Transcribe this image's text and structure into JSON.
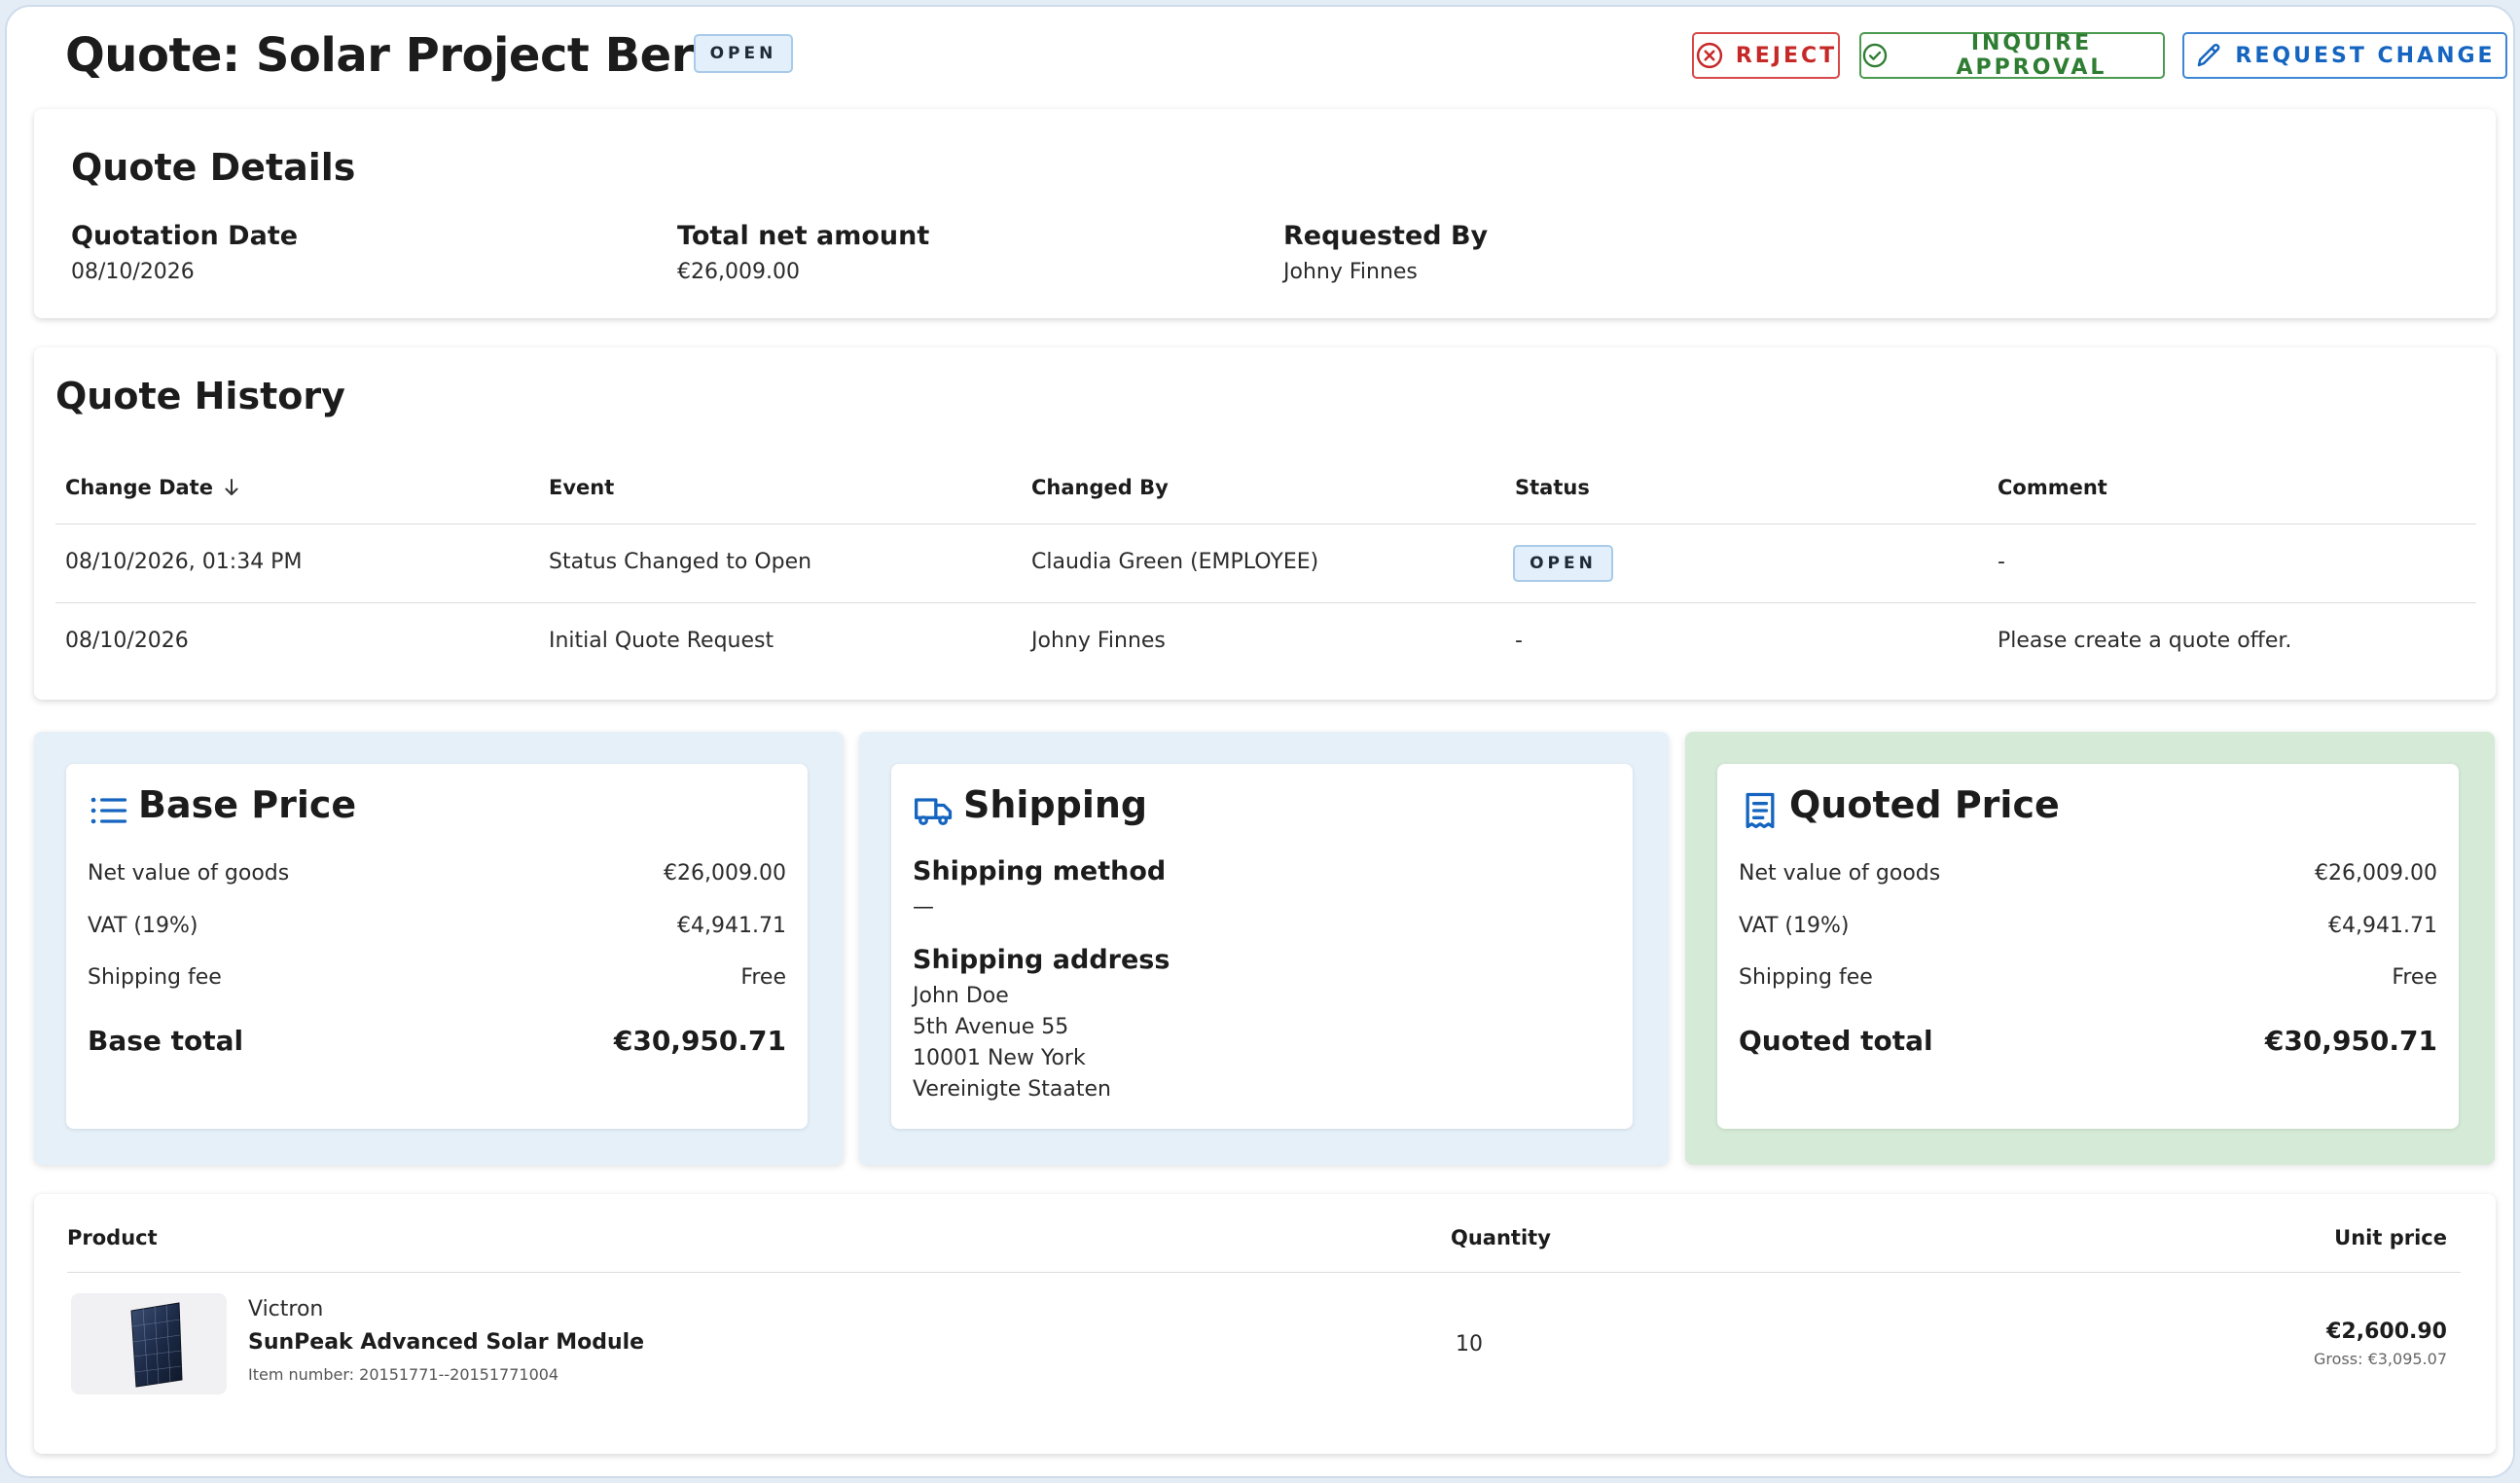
{
  "header": {
    "title": "Quote: Solar Project Berlin",
    "status": "OPEN",
    "buttons": {
      "reject": "REJECT",
      "inquire": "INQUIRE APPROVAL",
      "request": "REQUEST CHANGE"
    }
  },
  "details": {
    "heading": "Quote Details",
    "fields": [
      {
        "label": "Quotation Date",
        "value": "08/10/2026"
      },
      {
        "label": "Total net amount",
        "value": "€26,009.00"
      },
      {
        "label": "Requested By",
        "value": "Johny Finnes"
      }
    ]
  },
  "history": {
    "heading": "Quote History",
    "columns": [
      "Change Date",
      "Event",
      "Changed By",
      "Status",
      "Comment"
    ],
    "rows": [
      {
        "date": "08/10/2026, 01:34 PM",
        "event": "Status Changed to Open",
        "by": "Claudia Green (EMPLOYEE)",
        "status": "OPEN",
        "comment": "-"
      },
      {
        "date": "08/10/2026",
        "event": "Initial Quote Request",
        "by": "Johny Finnes",
        "status": "-",
        "comment": "Please create a quote offer."
      }
    ]
  },
  "base_price": {
    "title": "Base Price",
    "icon": "list-icon",
    "rows": [
      {
        "label": "Net value of goods",
        "value": "€26,009.00"
      },
      {
        "label": "VAT (19%)",
        "value": "€4,941.71"
      },
      {
        "label": "Shipping fee",
        "value": "Free"
      }
    ],
    "total_label": "Base total",
    "total_value": "€30,950.71"
  },
  "shipping": {
    "title": "Shipping",
    "icon": "truck-icon",
    "method_label": "Shipping method",
    "method_value": "—",
    "address_label": "Shipping address",
    "address_lines": [
      "John Doe",
      "5th Avenue 55",
      "10001 New York",
      "Vereinigte Staaten"
    ]
  },
  "quoted_price": {
    "title": "Quoted Price",
    "icon": "receipt-icon",
    "rows": [
      {
        "label": "Net value of goods",
        "value": "€26,009.00"
      },
      {
        "label": "VAT (19%)",
        "value": "€4,941.71"
      },
      {
        "label": "Shipping fee",
        "value": "Free"
      }
    ],
    "total_label": "Quoted total",
    "total_value": "€30,950.71"
  },
  "products": {
    "columns": {
      "product": "Product",
      "quantity": "Quantity",
      "unit_price": "Unit price"
    },
    "items": [
      {
        "brand": "Victron",
        "name": "SunPeak Advanced Solar Module",
        "item_number": "Item number: 20151771--20151771004",
        "quantity": "10",
        "price": "€2,600.90",
        "gross": "Gross: €3,095.07"
      }
    ]
  },
  "colors": {
    "accent_blue": "#1565c0",
    "reject_red": "#c62828",
    "approve_green": "#2e7d32",
    "panel_blue": "#e6f0f9",
    "panel_green": "#d5ead7"
  }
}
